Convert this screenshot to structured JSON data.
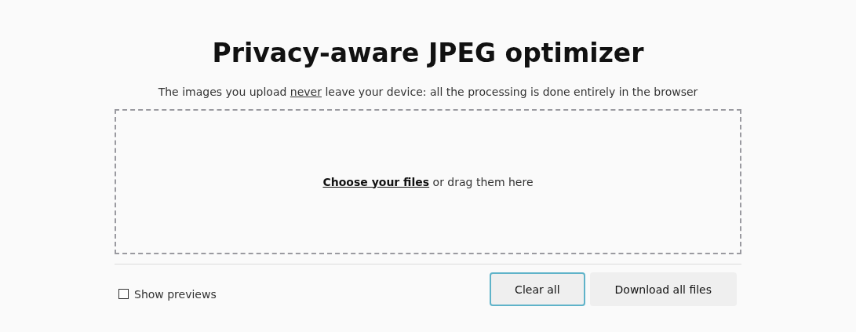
{
  "title": "Privacy-aware JPEG optimizer",
  "subtitle": {
    "before": "The images you upload ",
    "underlined": "never",
    "after": " leave your device: all the processing is done entirely in the browser"
  },
  "dropzone": {
    "link": "Choose your files",
    "text": " or drag them here"
  },
  "show_previews": {
    "label": "Show previews",
    "checked": false
  },
  "buttons": [
    {
      "label": "Clear all",
      "focused": true
    },
    {
      "label": "Download all files",
      "focused": false
    }
  ]
}
